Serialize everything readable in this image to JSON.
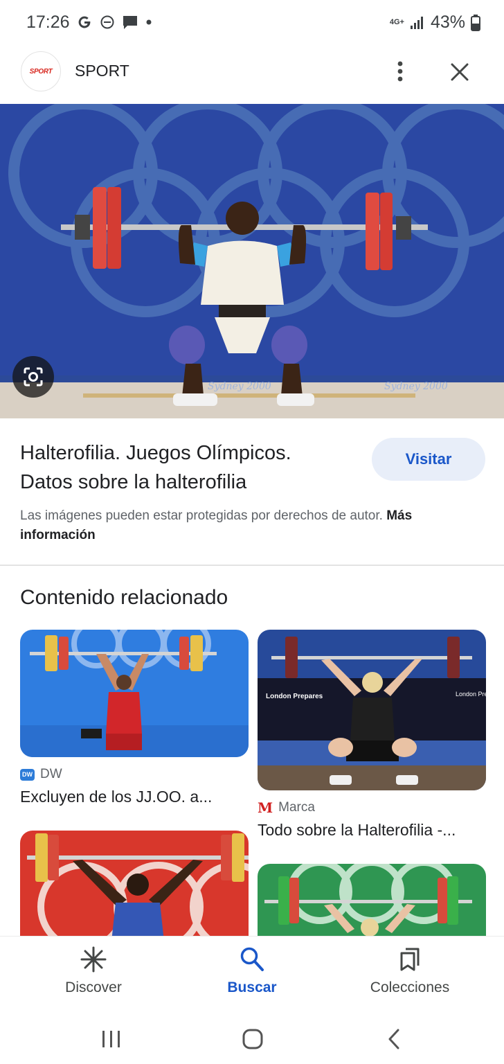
{
  "status_bar": {
    "time": "17:26",
    "network": "4G+",
    "battery": "43%",
    "icons": [
      "google-g-icon",
      "do-not-disturb-icon",
      "chat-icon",
      "dot-icon",
      "signal-icon",
      "battery-icon"
    ]
  },
  "header": {
    "logo_text": "SPORT",
    "site_name": "SPORT",
    "icons": [
      "more-vert-icon",
      "close-icon"
    ]
  },
  "hero": {
    "watermark_left": "Sydney 2000",
    "watermark_right": "Sydney 2000"
  },
  "result": {
    "title": "Halterofilia. Juegos Olímpicos. Datos sobre la halterofilia",
    "visit_label": "Visitar",
    "copyright_text": "Las imágenes pueden estar protegidas por derechos de autor.",
    "more_info_label": "Más información"
  },
  "related": {
    "heading": "Contenido relacionado",
    "cards": [
      {
        "source": "DW",
        "title": "Excluyen de los JJ.OO. a..."
      },
      {
        "source": "Marca",
        "title": "Todo sobre la Halterofilia -..."
      },
      {
        "source": "",
        "title": ""
      },
      {
        "source": "",
        "title": ""
      }
    ],
    "card2_banner_left": "London Prepares",
    "card2_banner_right": "London Pre"
  },
  "bottom_nav": {
    "items": [
      {
        "label": "Discover",
        "icon": "asterisk-icon"
      },
      {
        "label": "Buscar",
        "icon": "search-icon",
        "active": true
      },
      {
        "label": "Colecciones",
        "icon": "collections-icon"
      }
    ]
  },
  "colors": {
    "accent": "#1a57c9",
    "visit_bg": "#e8eef9",
    "text": "#202124",
    "secondary": "#5f6368"
  }
}
